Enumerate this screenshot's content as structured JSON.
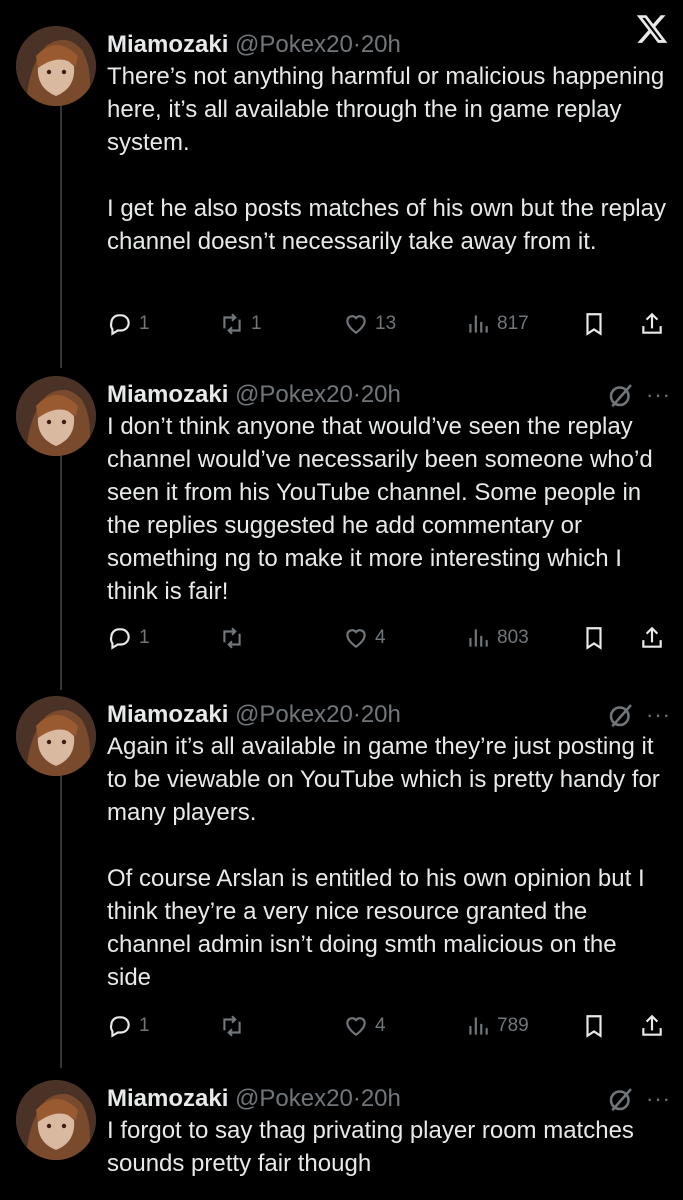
{
  "tweets": [
    {
      "name": "Miamozaki",
      "handle": "@Pokex20",
      "sep": "·",
      "time": "20h",
      "paragraphs": [
        "There’s not anything harmful or malicious happening here, it’s all available through the in game replay system.",
        "I get he also posts matches of his own but the replay channel doesn’t necessarily take away from it."
      ],
      "replies": "1",
      "reposts": "1",
      "likes": "13",
      "views": "817"
    },
    {
      "name": "Miamozaki",
      "handle": "@Pokex20",
      "sep": "·",
      "time": "20h",
      "paragraphs": [
        "I don’t think anyone that would’ve seen the replay channel would’ve necessarily been someone who’d seen it from his YouTube channel. Some people in the replies suggested he add commentary or something  ng to make it more interesting which I think is fair!"
      ],
      "replies": "1",
      "reposts": "",
      "likes": "4",
      "views": "803"
    },
    {
      "name": "Miamozaki",
      "handle": "@Pokex20",
      "sep": "·",
      "time": "20h",
      "paragraphs": [
        "Again it’s all available in game they’re just posting it to be viewable on YouTube which is pretty handy for many players.",
        "Of course Arslan is entitled to his own opinion but I think they’re a very nice resource granted the channel admin isn’t doing smth malicious on the side"
      ],
      "replies": "1",
      "reposts": "",
      "likes": "4",
      "views": "789"
    },
    {
      "name": "Miamozaki",
      "handle": "@Pokex20",
      "sep": "·",
      "time": "20h",
      "paragraphs": [
        "I forgot to say thag privating player room matches sounds pretty fair though"
      ]
    }
  ],
  "icons": {
    "logo": "x-logo-icon",
    "reply": "reply-icon",
    "repost": "repost-icon",
    "like": "heart-icon",
    "views": "views-icon",
    "bookmark": "bookmark-icon",
    "share": "share-icon",
    "grok": "grok-icon",
    "more": "more-icon"
  },
  "colors": {
    "background": "#000000",
    "text": "#e7e9ea",
    "muted": "#71767b"
  }
}
